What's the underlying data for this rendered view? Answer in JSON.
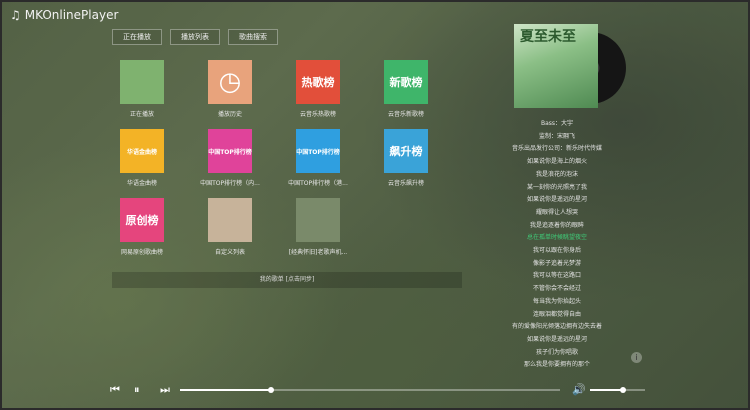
{
  "app": {
    "title": "MKOnlinePlayer",
    "icon": "music-note-icon"
  },
  "tabs": [
    {
      "label": "正在播放"
    },
    {
      "label": "播放列表"
    },
    {
      "label": "歌曲搜索"
    }
  ],
  "playlists": [
    {
      "caption": "正在播放",
      "cover_text": "",
      "cover_color": "#7fb26f"
    },
    {
      "caption": "播放历史",
      "cover_text": "",
      "cover_color": "#e8a37c",
      "icon": "clock-history-icon"
    },
    {
      "caption": "云音乐热歌榜",
      "cover_text": "热歌榜",
      "cover_color": "#e24f3a"
    },
    {
      "caption": "云音乐新歌榜",
      "cover_text": "新歌榜",
      "cover_color": "#3fb56a"
    },
    {
      "caption": "华语金曲榜",
      "cover_text": "华语金曲榜",
      "cover_color": "#f3b326"
    },
    {
      "caption": "中国TOP排行榜（内...",
      "cover_text": "中国TOP排行榜",
      "cover_color": "#e0439a"
    },
    {
      "caption": "中国TOP排行榜（港...",
      "cover_text": "中国TOP排行榜",
      "cover_color": "#2f9fe0"
    },
    {
      "caption": "云音乐飙升榜",
      "cover_text": "飙升榜",
      "cover_color": "#3aa3d8"
    },
    {
      "caption": "网易原创歌曲榜",
      "cover_text": "原创榜",
      "cover_color": "#e5457d"
    },
    {
      "caption": "自定义列表",
      "cover_text": "",
      "cover_color": "#c7b39a"
    },
    {
      "caption": "[经典怀旧]老歌声机...",
      "cover_text": "",
      "cover_color": "#7a8a6a"
    }
  ],
  "my_music": "我的歌单 [点击同步]",
  "album": {
    "title": "夏至未至"
  },
  "lyrics": [
    "Bass：大宇",
    "监制：宋翮飞",
    "音乐出品发行公司：新乐时代传媒",
    "如果说你是海上的烟火",
    "我是浪花的泡沫",
    "某一刻你的光照亮了我",
    "如果说你是遥远的星河",
    "耀眼得让人想哭",
    "我是追逐着你的眼眸",
    "总在孤单时候眺望夜空",
    "我可以跟在你身后",
    "像影子追着光梦游",
    "我可以等在这路口",
    "不管你会不会经过",
    "每当我为你抬起头",
    "连眼泪都觉得自由",
    "有的爱像阳光倾落边拥有边失去着",
    "如果说你是遥远的星河",
    "孩子们为你唱歌",
    "那么我是你要拥有的那个"
  ],
  "active_lyric_index": 9,
  "player": {
    "progress_percent": 24,
    "volume_percent": 60
  },
  "colors": {
    "accent_green": "#3fcf7a"
  }
}
